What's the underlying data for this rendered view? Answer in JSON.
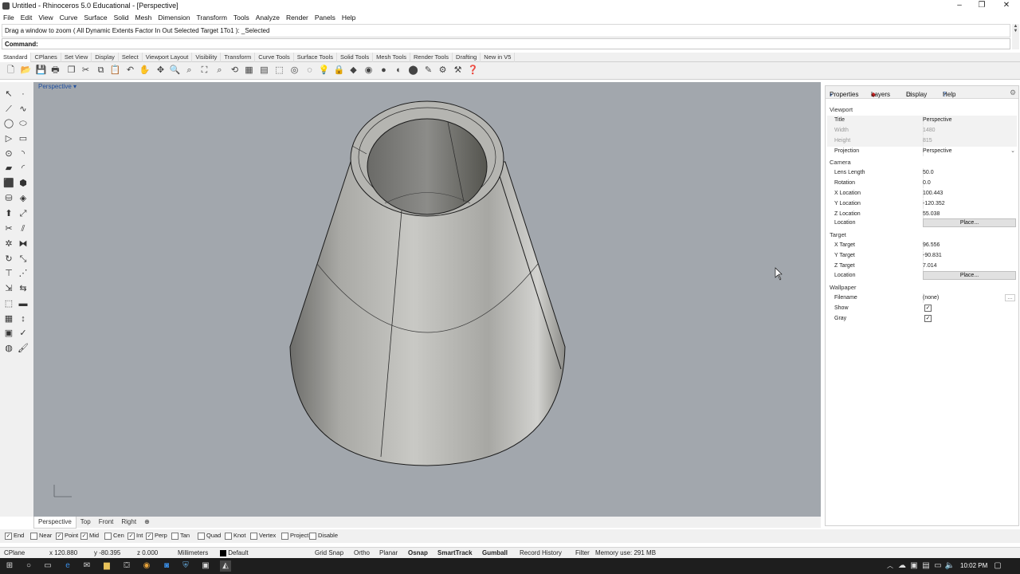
{
  "window": {
    "title": "Untitled - Rhinoceros 5.0 Educational - [Perspective]",
    "controls": [
      "–",
      "❐",
      "✕"
    ]
  },
  "menu": [
    "File",
    "Edit",
    "View",
    "Curve",
    "Surface",
    "Solid",
    "Mesh",
    "Dimension",
    "Transform",
    "Tools",
    "Analyze",
    "Render",
    "Panels",
    "Help"
  ],
  "command_history": "Drag a window to zoom ( All  Dynamic  Extents  Factor  In  Out  Selected  Target  1To1 ): _Selected",
  "command_prompt": "Command:",
  "toolbar_tabs": [
    "Standard",
    "CPlanes",
    "Set View",
    "Display",
    "Select",
    "Viewport Layout",
    "Visibility",
    "Transform",
    "Curve Tools",
    "Surface Tools",
    "Solid Tools",
    "Mesh Tools",
    "Render Tools",
    "Drafting",
    "New in V5"
  ],
  "viewport": {
    "title": "Perspective",
    "dropdown": "▾",
    "tabs": [
      "Perspective",
      "Top",
      "Front",
      "Right",
      "⊕"
    ]
  },
  "panel": {
    "tabs": [
      "Properties",
      "Layers",
      "Display",
      "Help"
    ],
    "sections": {
      "viewport": "Viewport",
      "camera": "Camera",
      "target": "Target",
      "wallpaper": "Wallpaper"
    },
    "viewport_rows": [
      {
        "label": "Title",
        "value": "Perspective"
      },
      {
        "label": "Width",
        "value": "1480"
      },
      {
        "label": "Height",
        "value": "815"
      },
      {
        "label": "Projection",
        "value": "Perspective"
      }
    ],
    "camera_rows": [
      {
        "label": "Lens Length",
        "value": "50.0"
      },
      {
        "label": "Rotation",
        "value": "0.0"
      },
      {
        "label": "X Location",
        "value": "100.443"
      },
      {
        "label": "Y Location",
        "value": "-120.352"
      },
      {
        "label": "Z Location",
        "value": "55.038"
      },
      {
        "label": "Location",
        "value": "Place..."
      }
    ],
    "target_rows": [
      {
        "label": "X Target",
        "value": "96.556"
      },
      {
        "label": "Y Target",
        "value": "-90.831"
      },
      {
        "label": "Z Target",
        "value": "7.014"
      },
      {
        "label": "Location",
        "value": "Place..."
      }
    ],
    "wallpaper_rows": [
      {
        "label": "Filename",
        "value": "(none)"
      },
      {
        "label": "Show",
        "checked": true
      },
      {
        "label": "Gray",
        "checked": true
      }
    ]
  },
  "osnap": [
    {
      "label": "End",
      "checked": true
    },
    {
      "label": "Near",
      "checked": false
    },
    {
      "label": "Point",
      "checked": true
    },
    {
      "label": "Mid",
      "checked": true
    },
    {
      "label": "Cen",
      "checked": false
    },
    {
      "label": "Int",
      "checked": true
    },
    {
      "label": "Perp",
      "checked": true
    },
    {
      "label": "Tan",
      "checked": false
    },
    {
      "label": "Quad",
      "checked": false
    },
    {
      "label": "Knot",
      "checked": false
    },
    {
      "label": "Vertex",
      "checked": false
    },
    {
      "label": "Project",
      "checked": false
    },
    {
      "label": "Disable",
      "checked": false
    }
  ],
  "status": {
    "cplane": "CPlane",
    "x": "x 120.880",
    "y": "y -80.395",
    "z": "z 0.000",
    "units": "Millimeters",
    "layer": "Default",
    "toggles": [
      "Grid Snap",
      "Ortho",
      "Planar",
      "Osnap",
      "SmartTrack",
      "Gumball",
      "Record History",
      "Filter"
    ],
    "memory": "Memory use: 291 MB"
  },
  "taskbar": {
    "time": "10:02 PM"
  },
  "colors": {
    "viewport_bg": "#a2a7ad",
    "accent": "#2050a0",
    "taskbar": "#1e1e1e"
  }
}
